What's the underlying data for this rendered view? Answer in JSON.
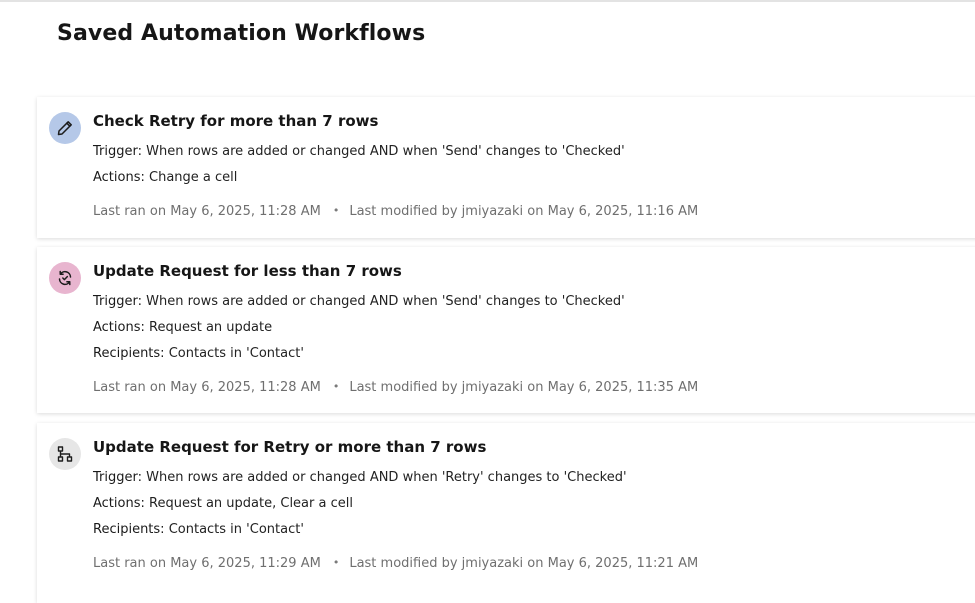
{
  "page": {
    "title": "Saved Automation Workflows"
  },
  "workflows": [
    {
      "icon": "pencil-icon",
      "icon_bg": "#b5c8e8",
      "title": "Check Retry for more than 7 rows",
      "trigger_label": "Trigger:",
      "trigger": "When rows are added or changed AND when 'Send' changes to 'Checked'",
      "actions_label": "Actions:",
      "actions": "Change a cell",
      "last_ran": "Last ran on May 6, 2025, 11:28 AM",
      "separator": "•",
      "last_modified": "Last modified by jmiyazaki on May 6, 2025, 11:16 AM"
    },
    {
      "icon": "refresh-request-icon",
      "icon_bg": "#e8b5cf",
      "title": "Update Request for less than 7 rows",
      "trigger_label": "Trigger:",
      "trigger": "When rows are added or changed AND when 'Send' changes to 'Checked'",
      "actions_label": "Actions:",
      "actions": "Request an update",
      "recipients_label": "Recipients:",
      "recipients": "Contacts in 'Contact'",
      "last_ran": "Last ran on May 6, 2025, 11:28 AM",
      "separator": "•",
      "last_modified": "Last modified by jmiyazaki on May 6, 2025, 11:35 AM"
    },
    {
      "icon": "workflow-branch-icon",
      "icon_bg": "#e6e6e6",
      "title": "Update Request for Retry or more than 7 rows",
      "trigger_label": "Trigger:",
      "trigger": "When rows are added or changed AND when 'Retry' changes to 'Checked'",
      "actions_label": "Actions:",
      "actions": "Request an update, Clear a cell",
      "recipients_label": "Recipients:",
      "recipients": "Contacts in 'Contact'",
      "last_ran": "Last ran on May 6, 2025, 11:29 AM",
      "separator": "•",
      "last_modified": "Last modified by jmiyazaki on May 6, 2025, 11:21 AM"
    }
  ]
}
